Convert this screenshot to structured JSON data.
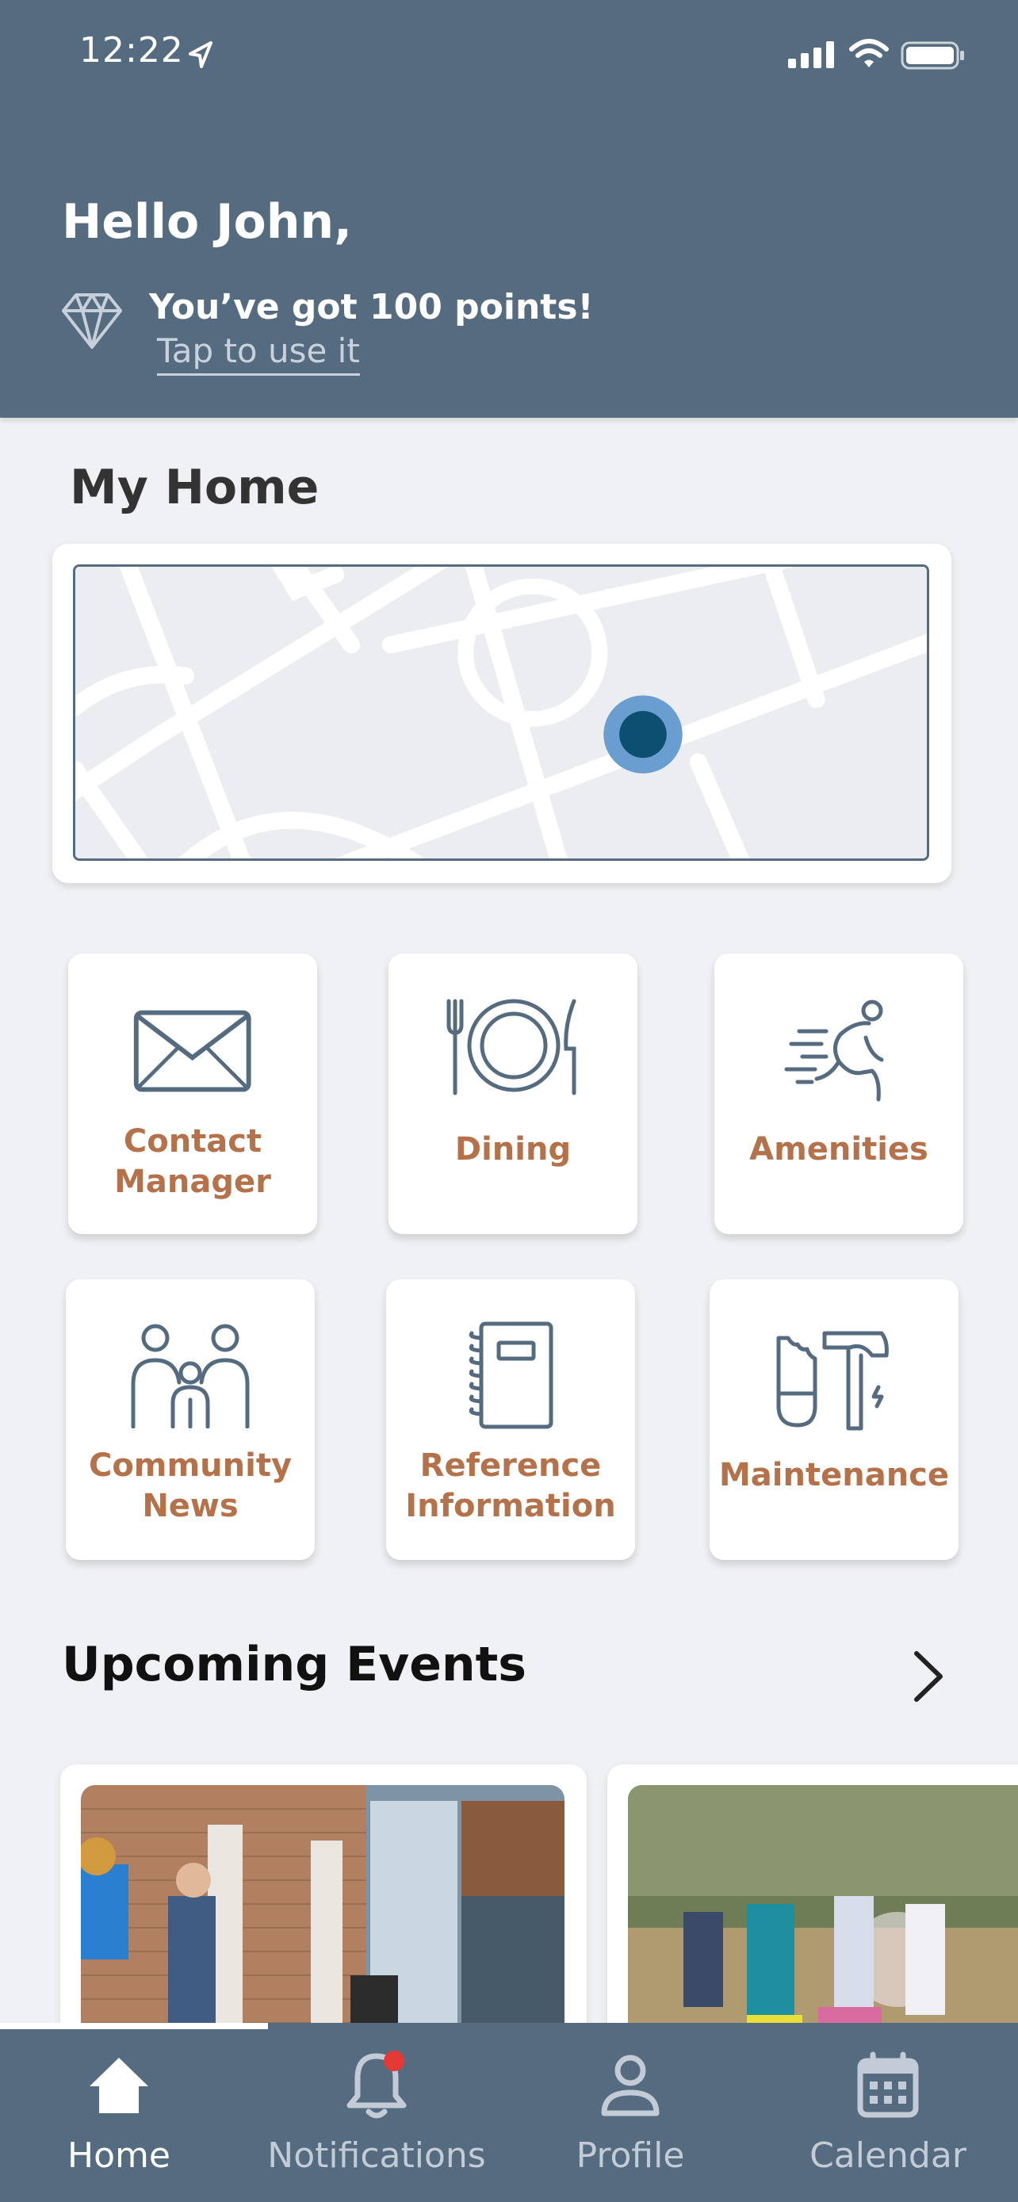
{
  "status_bar": {
    "time": "12:22"
  },
  "header": {
    "greeting": "Hello John,",
    "points_text": "You’ve got 100 points!",
    "tap_link": "Tap to use it"
  },
  "my_home": {
    "title": "My Home"
  },
  "tiles": [
    {
      "label_line1": "Contact",
      "label_line2": "Manager",
      "icon": "envelope-icon"
    },
    {
      "label_line1": "Dining",
      "label_line2": "",
      "icon": "plate-cutlery-icon"
    },
    {
      "label_line1": "Amenities",
      "label_line2": "",
      "icon": "running-person-icon"
    },
    {
      "label_line1": "Community",
      "label_line2": "News",
      "icon": "people-icon"
    },
    {
      "label_line1": "Reference",
      "label_line2": "Information",
      "icon": "notebook-icon"
    },
    {
      "label_line1": "Maintenance",
      "label_line2": "",
      "icon": "tools-icon"
    }
  ],
  "events": {
    "title": "Upcoming Events"
  },
  "tab_bar": {
    "items": [
      {
        "label": "Home",
        "icon": "home-icon",
        "active": true
      },
      {
        "label": "Notifications",
        "icon": "bell-icon",
        "active": false
      },
      {
        "label": "Profile",
        "icon": "person-icon",
        "active": false
      },
      {
        "label": "Calendar",
        "icon": "calendar-icon",
        "active": false
      }
    ]
  },
  "colors": {
    "header_bg": "#556b80",
    "accent_label": "#b4714a",
    "page_bg": "#f0f1f4",
    "map_pin": "#0d4f6e",
    "notification_dot": "#e53935"
  }
}
